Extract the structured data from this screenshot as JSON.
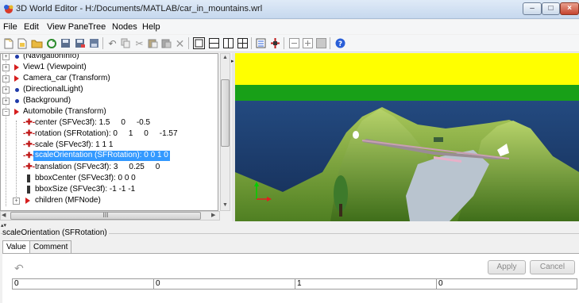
{
  "window": {
    "title": "3D World Editor - H:/Documents/MATLAB/car_in_mountains.wrl",
    "minimize": "–",
    "maximize": "□",
    "close": "×"
  },
  "menu": [
    "File",
    "Edit",
    "View Pane",
    "Tree",
    "Nodes",
    "Help"
  ],
  "toolbar_icons": [
    "new-icon",
    "new-from-template-icon",
    "open-icon",
    "reload-icon",
    "save-icon",
    "save-as-icon",
    "export-icon",
    "undo-icon",
    "copy-icon",
    "cut-icon",
    "paste-icon",
    "paste-special-icon",
    "delete-icon",
    "single-pane-icon",
    "horizontal-split-icon",
    "vertical-split-icon",
    "quad-split-icon",
    "tree-view-icon",
    "field-editor-icon",
    "zoom-out-icon",
    "zoom-in-icon",
    "zoom-normal-icon",
    "help-icon"
  ],
  "tree": {
    "nodes": [
      {
        "label": "(NavigationInfo)"
      },
      {
        "label": "View1 (Viewpoint)"
      },
      {
        "label": "Camera_car (Transform)"
      },
      {
        "label": "(DirectionalLight)"
      },
      {
        "label": "(Background)"
      },
      {
        "label": "Automobile (Transform)"
      },
      {
        "label": "center (SFVec3f): 1.5     0     -0.5"
      },
      {
        "label": "rotation (SFRotation): 0     1     0     -1.57"
      },
      {
        "label": "scale (SFVec3f): 1 1 1"
      },
      {
        "label": "scaleOrientation (SFRotation): 0 0 1 0"
      },
      {
        "label": "translation (SFVec3f): 3     0.25     0"
      },
      {
        "label": "bboxCenter (SFVec3f): 0 0 0"
      },
      {
        "label": "bboxSize (SFVec3f): -1 -1 -1"
      },
      {
        "label": "children (MFNode)"
      }
    ],
    "scroll_thumb_label": "III"
  },
  "field_editor": {
    "title": "scaleOrientation (SFRotation)",
    "tabs": [
      "Value",
      "Comment"
    ],
    "apply_label": "Apply",
    "cancel_label": "Cancel",
    "values": [
      "0",
      "0",
      "1",
      "0"
    ]
  },
  "colors": {
    "sky": "#ffff00",
    "ground": "#1d3b6a",
    "terrain": "#7aa83a",
    "selection": "#3399ff",
    "node_marker": "#d61e1e"
  }
}
